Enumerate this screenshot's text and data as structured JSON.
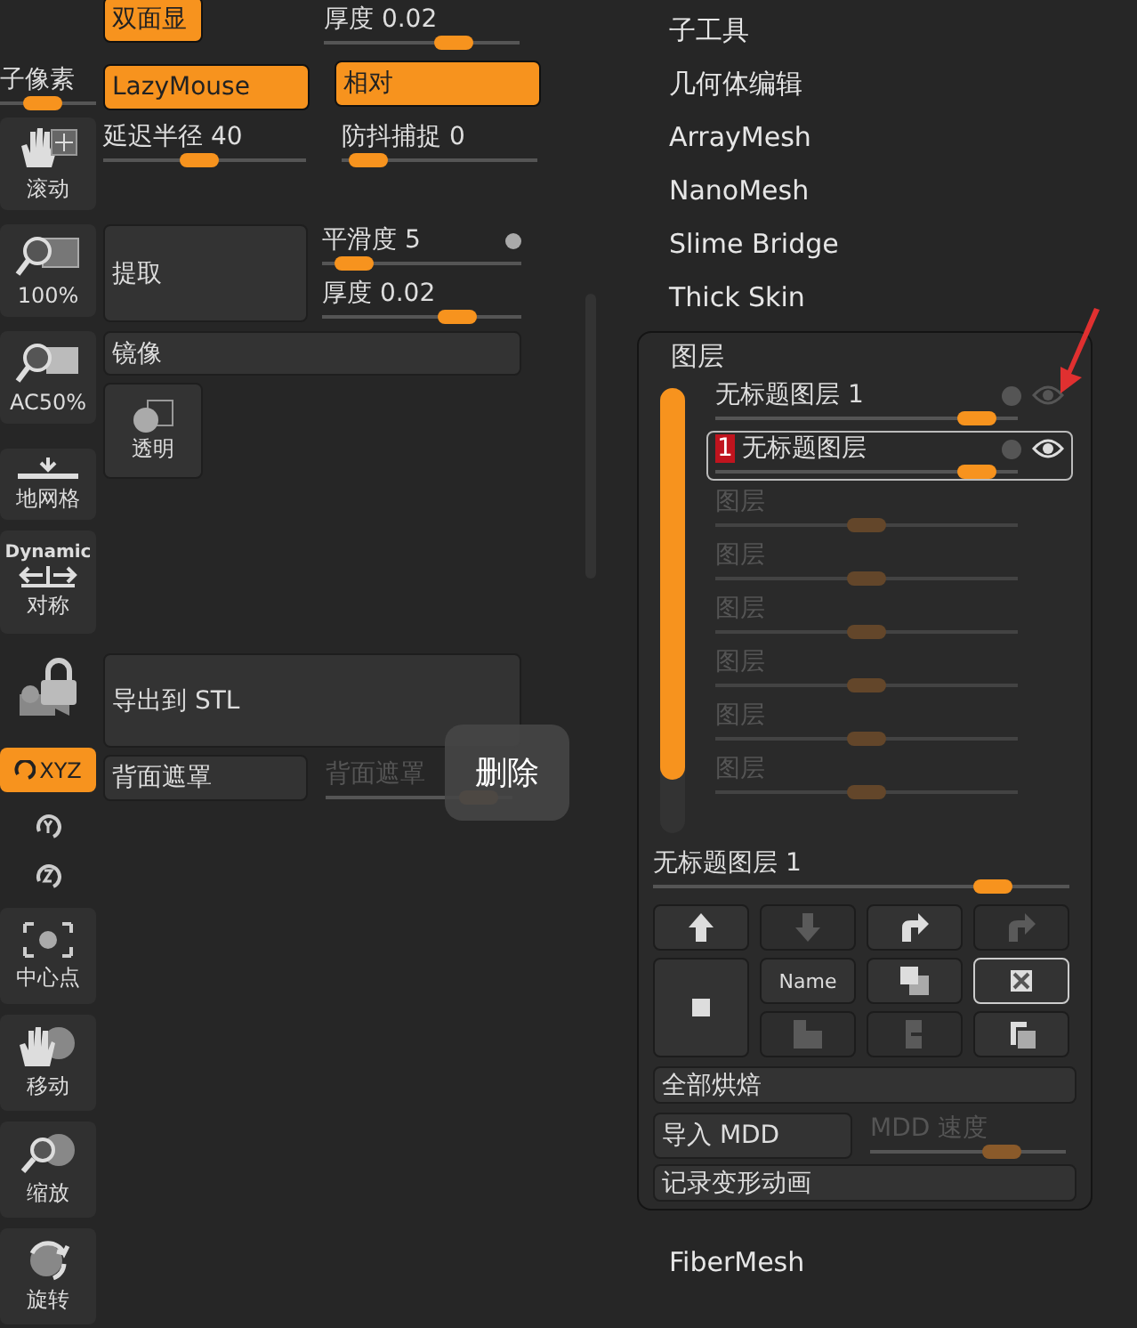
{
  "tool_strip": {
    "subpixel": {
      "label": "子像素",
      "level": 0.42
    },
    "buttons": [
      {
        "label": "滚动"
      },
      {
        "label": "100%"
      },
      {
        "label": "AC50%"
      },
      {
        "label": "地网格"
      }
    ],
    "symmetry": {
      "caption": "Dynamic",
      "label": "对称"
    },
    "xyz": {
      "label": "XYZ",
      "on": true
    },
    "nav_buttons": [
      {
        "label": "中心点"
      },
      {
        "label": "移动"
      },
      {
        "label": "缩放"
      },
      {
        "label": "旋转"
      }
    ]
  },
  "options": {
    "double_sided": {
      "label": "双面显",
      "on": true
    },
    "thickness_top": {
      "label": "厚度 0.02",
      "level": 0.7
    },
    "lazymouse": {
      "label": "LazyMouse",
      "on": true
    },
    "relative": {
      "label": "相对",
      "on": true
    },
    "lazy_radius": {
      "label": "延迟半径 40",
      "level": 0.47
    },
    "anti_shake": {
      "label": "防抖捕捉 0",
      "level": 0.05
    },
    "extract": {
      "label": "提取"
    },
    "smooth": {
      "label": "平滑度 5",
      "level": 0.08
    },
    "thickness": {
      "label": "厚度 0.02",
      "level": 0.72
    },
    "mirror": {
      "label": "镜像"
    },
    "transparent": {
      "label": "透明"
    },
    "export_stl": {
      "label": "导出到 STL"
    },
    "backface_mask": {
      "label": "背面遮罩"
    },
    "backface_strength": {
      "label": "背面遮罩",
      "level": 0.9,
      "disabled": true
    }
  },
  "tooltip": {
    "text": "删除"
  },
  "menu": [
    "子工具",
    "几何体编辑",
    "ArrayMesh",
    "NanoMesh",
    "Slime Bridge",
    "Thick Skin"
  ],
  "layers": {
    "title": "图层",
    "items": [
      {
        "name": "无标题图层 1",
        "selected": false,
        "disabled": false,
        "visible": false,
        "level": 0.92
      },
      {
        "badge": "1",
        "name": "无标题图层",
        "selected": true,
        "disabled": false,
        "visible": true,
        "level": 0.92
      },
      {
        "name": "图层",
        "selected": false,
        "disabled": true,
        "level": 0.5
      },
      {
        "name": "图层",
        "selected": false,
        "disabled": true,
        "level": 0.5
      },
      {
        "name": "图层",
        "selected": false,
        "disabled": true,
        "level": 0.5
      },
      {
        "name": "图层",
        "selected": false,
        "disabled": true,
        "level": 0.5
      },
      {
        "name": "图层",
        "selected": false,
        "disabled": true,
        "level": 0.5
      },
      {
        "name": "图层",
        "selected": false,
        "disabled": true,
        "level": 0.5
      }
    ],
    "current": {
      "label": "无标题图层 1",
      "level": 0.85
    },
    "buttons": [
      {
        "kind": "up",
        "disabled": false,
        "selected": false
      },
      {
        "kind": "down",
        "disabled": true,
        "selected": false
      },
      {
        "kind": "redo",
        "disabled": false,
        "selected": false
      },
      {
        "kind": "redo",
        "disabled": true,
        "selected": false
      },
      {
        "kind": "new",
        "disabled": false,
        "selected": false
      },
      {
        "kind": "name",
        "label": "Name",
        "disabled": false,
        "selected": false
      },
      {
        "kind": "duplicate",
        "disabled": false,
        "selected": false
      },
      {
        "kind": "delete",
        "disabled": false,
        "selected": true
      },
      {
        "kind": "merge",
        "disabled": true,
        "selected": false
      },
      {
        "kind": "split",
        "disabled": true,
        "selected": false
      },
      {
        "kind": "copy",
        "disabled": false,
        "selected": false
      }
    ],
    "bake_all": "全部烘焙",
    "import_mdd": "导入 MDD",
    "mdd_speed": {
      "label": "MDD 速度",
      "level": 0.72,
      "disabled": true
    },
    "record": "记录变形动画"
  },
  "footer_menu": [
    "FiberMesh"
  ]
}
